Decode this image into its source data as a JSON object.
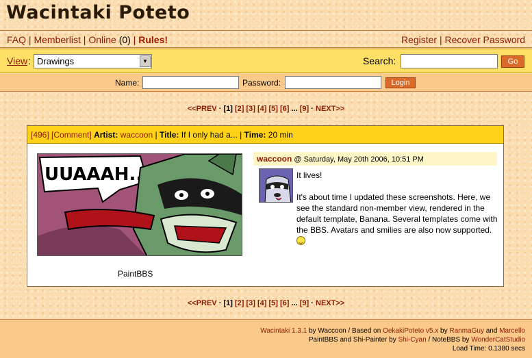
{
  "site": {
    "title": "Wacintaki Poteto"
  },
  "nav": {
    "faq": "FAQ",
    "memberlist": "Memberlist",
    "online": "Online",
    "online_count": "(0)",
    "rules": "Rules!",
    "register": "Register",
    "recover": "Recover Password",
    "sep": "|"
  },
  "view_bar": {
    "view_label": "View",
    "view_colon": ":",
    "view_selected": "Drawings",
    "search_label": "Search:",
    "search_value": "",
    "go_label": "Go"
  },
  "login": {
    "name_label": "Name:",
    "password_label": "Password:",
    "login_label": "Login"
  },
  "pager": {
    "prev": "<<PREV",
    "dot": "·",
    "current": "[1]",
    "pages": [
      "[2]",
      "[3]",
      "[4]",
      "[5]",
      "[6]"
    ],
    "ellipsis": "...",
    "last": "[9]",
    "next": "NEXT>>"
  },
  "post": {
    "number": "[496]",
    "comment_link": "[Comment]",
    "artist_label": "Artist:",
    "artist": "waccoon",
    "title_label": "Title:",
    "title": "If I only had a...",
    "time_label": "Time:",
    "time": "20 min",
    "sep": "|",
    "drawing_text": "UUAAAH...",
    "caption": "PaintBBS"
  },
  "comment": {
    "author": "waccoon",
    "date": "@ Saturday, May 20th 2006, 10:51 PM",
    "line1": "It lives!",
    "line2": "It's about time I updated these screenshots. Here, we see the standard non-member view, rendered in the default template, Banana. Several templates come with the BBS. Avatars and smilies are also now supported."
  },
  "footer": {
    "version": "Wacintaki 1.3.1",
    "by": "by Waccoon / Based on",
    "oekaki": "OekakiPoteto v5.x",
    "by2": "by",
    "ranma": "RanmaGuy",
    "and": "and",
    "marcello": "Marcello",
    "paint_line": "PaintBBS and Shi-Painter by",
    "shicyan": "Shi-Cyan",
    "notebbs": "/ NoteBBS by",
    "wondercat": "WonderCatStudio",
    "load_time": "Load Time: 0.1380 secs"
  },
  "colors": {
    "accent": "#ffd21a",
    "link": "#8a1a00",
    "button": "#d96a2a"
  }
}
